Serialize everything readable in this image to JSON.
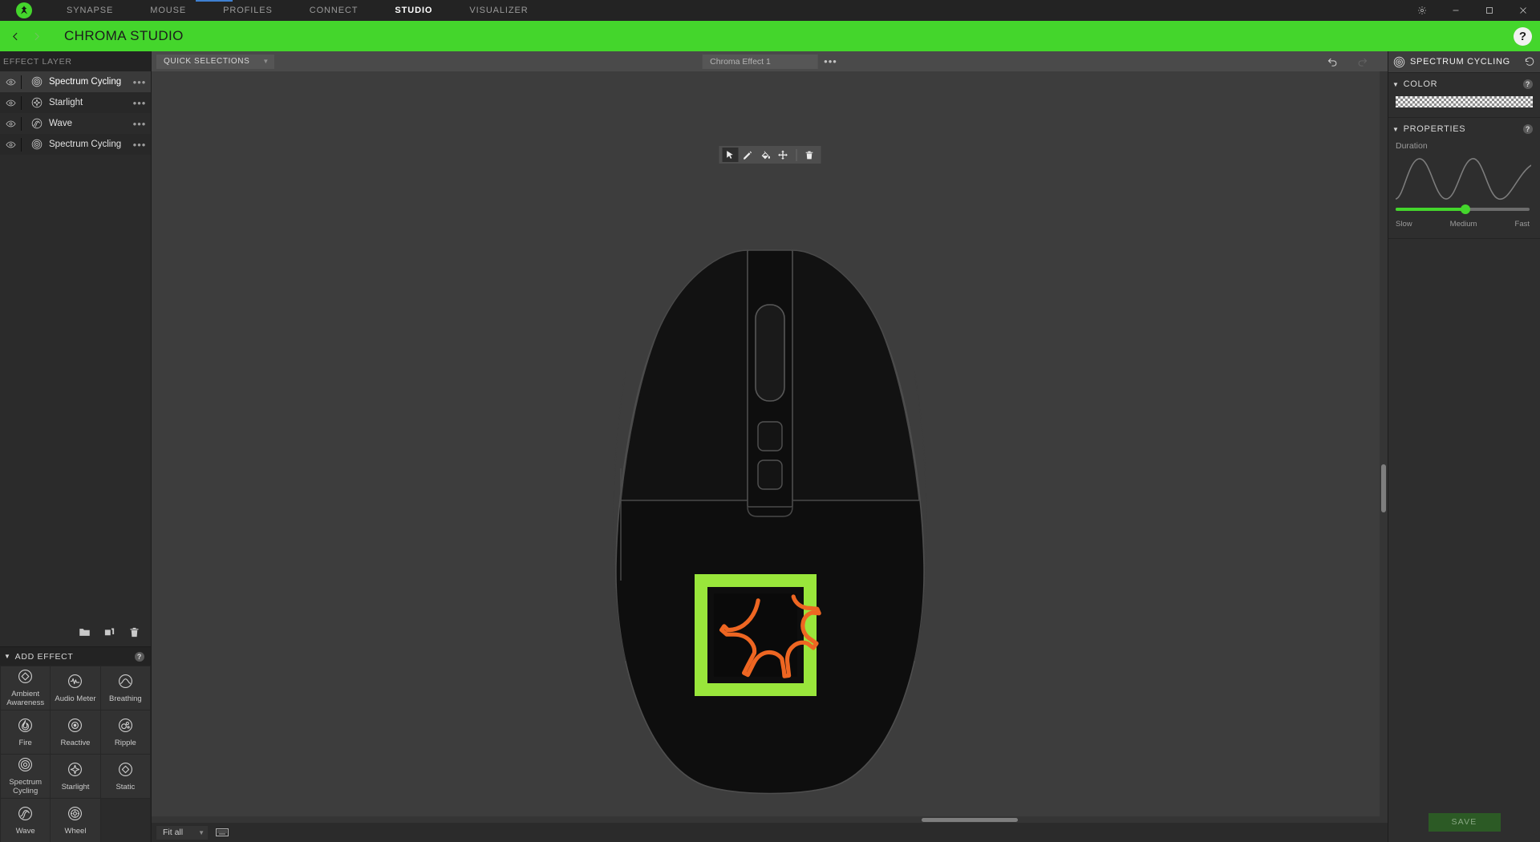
{
  "titlebar": {
    "logo_icon": "razer-logo-icon",
    "nav": [
      {
        "label": "SYNAPSE",
        "active": false
      },
      {
        "label": "MOUSE",
        "active": false
      },
      {
        "label": "PROFILES",
        "active": false
      },
      {
        "label": "CONNECT",
        "active": false
      },
      {
        "label": "STUDIO",
        "active": true
      },
      {
        "label": "VISUALIZER",
        "active": false
      }
    ],
    "controls": [
      {
        "name": "settings-gear-button",
        "icon": "gear-icon"
      },
      {
        "name": "minimize-button",
        "icon": "minimize-icon"
      },
      {
        "name": "maximize-button",
        "icon": "maximize-icon"
      },
      {
        "name": "close-button",
        "icon": "close-icon"
      }
    ],
    "accent_underline_color": "#3f7fd0"
  },
  "header": {
    "title": "CHROMA STUDIO",
    "back_icon": "chevron-left-icon",
    "forward_icon": "chevron-right-icon",
    "help_label": "?",
    "bg_color": "#44d62c"
  },
  "layers_panel": {
    "title": "EFFECT LAYER",
    "layers": [
      {
        "name": "Spectrum Cycling",
        "icon": "spectrum-cycling-icon",
        "selected": true,
        "visible": true
      },
      {
        "name": "Starlight",
        "icon": "starlight-icon",
        "selected": false,
        "visible": true
      },
      {
        "name": "Wave",
        "icon": "wave-icon",
        "selected": false,
        "visible": true
      },
      {
        "name": "Spectrum Cycling",
        "icon": "spectrum-cycling-icon",
        "selected": false,
        "visible": true
      }
    ],
    "tools": [
      {
        "name": "group-layers-button",
        "icon": "folder-icon"
      },
      {
        "name": "duplicate-layer-button",
        "icon": "copy-icon"
      },
      {
        "name": "delete-layer-button",
        "icon": "trash-icon"
      }
    ]
  },
  "add_effect": {
    "title": "ADD EFFECT",
    "help_label": "?",
    "effects": [
      {
        "label": "Ambient Awareness",
        "icon": "ambient-awareness-icon"
      },
      {
        "label": "Audio Meter",
        "icon": "audio-meter-icon"
      },
      {
        "label": "Breathing",
        "icon": "breathing-icon"
      },
      {
        "label": "Fire",
        "icon": "fire-icon"
      },
      {
        "label": "Reactive",
        "icon": "reactive-icon"
      },
      {
        "label": "Ripple",
        "icon": "ripple-icon"
      },
      {
        "label": "Spectrum Cycling",
        "icon": "spectrum-cycling-icon"
      },
      {
        "label": "Starlight",
        "icon": "starlight-icon"
      },
      {
        "label": "Static",
        "icon": "static-icon"
      },
      {
        "label": "Wave",
        "icon": "wave-icon"
      },
      {
        "label": "Wheel",
        "icon": "wheel-icon"
      }
    ]
  },
  "canvas": {
    "quick_selections_label": "QUICK SELECTIONS",
    "effect_tab_label": "Chroma Effect 1",
    "tab_menu_label": "•••",
    "undo_icon": "undo-icon",
    "redo_icon": "redo-icon",
    "tools": [
      {
        "name": "select-tool",
        "icon": "cursor-icon",
        "active": true
      },
      {
        "name": "pencil-tool",
        "icon": "pencil-icon",
        "active": false
      },
      {
        "name": "paint-bucket-tool",
        "icon": "paint-bucket-icon",
        "active": false
      },
      {
        "name": "move-tool",
        "icon": "move-icon",
        "active": false
      },
      {
        "name": "delete-tool",
        "icon": "trash-icon",
        "active": false
      }
    ],
    "device": "razer-mouse-top-view",
    "led_zone": {
      "name": "razer-logo-led-zone",
      "border_color": "#99e63b",
      "logo_color": "#ee6622"
    },
    "zoom_value": "Fit all",
    "keyboard_icon": "keyboard-icon"
  },
  "properties_panel": {
    "effect_name": "SPECTRUM CYCLING",
    "effect_icon": "spectrum-cycling-icon",
    "reset_icon": "reset-icon",
    "color_section": {
      "title": "COLOR",
      "help_label": "?",
      "swatch": "transparent-checker"
    },
    "properties_section": {
      "title": "PROPERTIES",
      "help_label": "?",
      "duration_label": "Duration",
      "slider": {
        "value_percent": 52,
        "labels": {
          "min": "Slow",
          "mid": "Medium",
          "max": "Fast"
        },
        "fill_color": "#44d62c"
      }
    },
    "save_label": "SAVE"
  }
}
